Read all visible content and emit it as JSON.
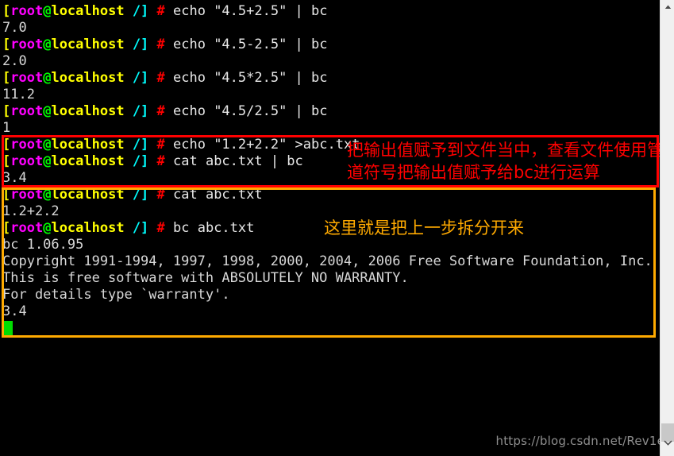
{
  "terminal": {
    "prompt": {
      "open_bracket": "[",
      "user": "root",
      "at": "@",
      "host": "localhost",
      "path": " /]",
      "hash": "#"
    },
    "colors": {
      "background": "#000000",
      "user": "#ff00ff",
      "host": "#ffff00",
      "bracket": "#ffff00",
      "at": "#00ff00",
      "path": "#00ffff",
      "hash": "#ff0000",
      "text": "#d8d8d8",
      "cursor": "#00dd00",
      "red_annotation": "#ff0000",
      "orange_annotation": "#ffaa00"
    },
    "lines": [
      {
        "type": "prompt",
        "command": " echo \"4.5+2.5\" | bc"
      },
      {
        "type": "output",
        "text": "7.0"
      },
      {
        "type": "prompt",
        "command": " echo \"4.5-2.5\" | bc"
      },
      {
        "type": "output",
        "text": "2.0"
      },
      {
        "type": "prompt",
        "command": " echo \"4.5*2.5\" | bc"
      },
      {
        "type": "output",
        "text": "11.2"
      },
      {
        "type": "prompt",
        "command": " echo \"4.5/2.5\" | bc"
      },
      {
        "type": "output",
        "text": "1"
      },
      {
        "type": "prompt",
        "command": " echo \"1.2+2.2\" >abc.txt"
      },
      {
        "type": "prompt",
        "command": " cat abc.txt | bc"
      },
      {
        "type": "output",
        "text": "3.4"
      },
      {
        "type": "prompt",
        "command": " cat abc.txt"
      },
      {
        "type": "output",
        "text": "1.2+2.2"
      },
      {
        "type": "prompt",
        "command": " bc abc.txt"
      },
      {
        "type": "output",
        "text": "bc 1.06.95"
      },
      {
        "type": "output",
        "text": "Copyright 1991-1994, 1997, 1998, 2000, 2004, 2006 Free Software Foundation, Inc."
      },
      {
        "type": "output",
        "text": "This is free software with ABSOLUTELY NO WARRANTY."
      },
      {
        "type": "output",
        "text": "For details type `warranty'."
      },
      {
        "type": "output",
        "text": "3.4"
      }
    ]
  },
  "annotations": {
    "red": {
      "line1": "把输出值赋予到文件当中，查看文件使用管",
      "line2": "道符号把输出值赋予给bc进行运算"
    },
    "orange": {
      "line1": "这里就是把上一步拆分开来"
    }
  },
  "watermark": {
    "text": "https://blog.csdn.net/Rev1e"
  },
  "scrollbar": {
    "up_arrow": "chevron-up-icon",
    "down_arrow": "chevron-down-icon"
  }
}
